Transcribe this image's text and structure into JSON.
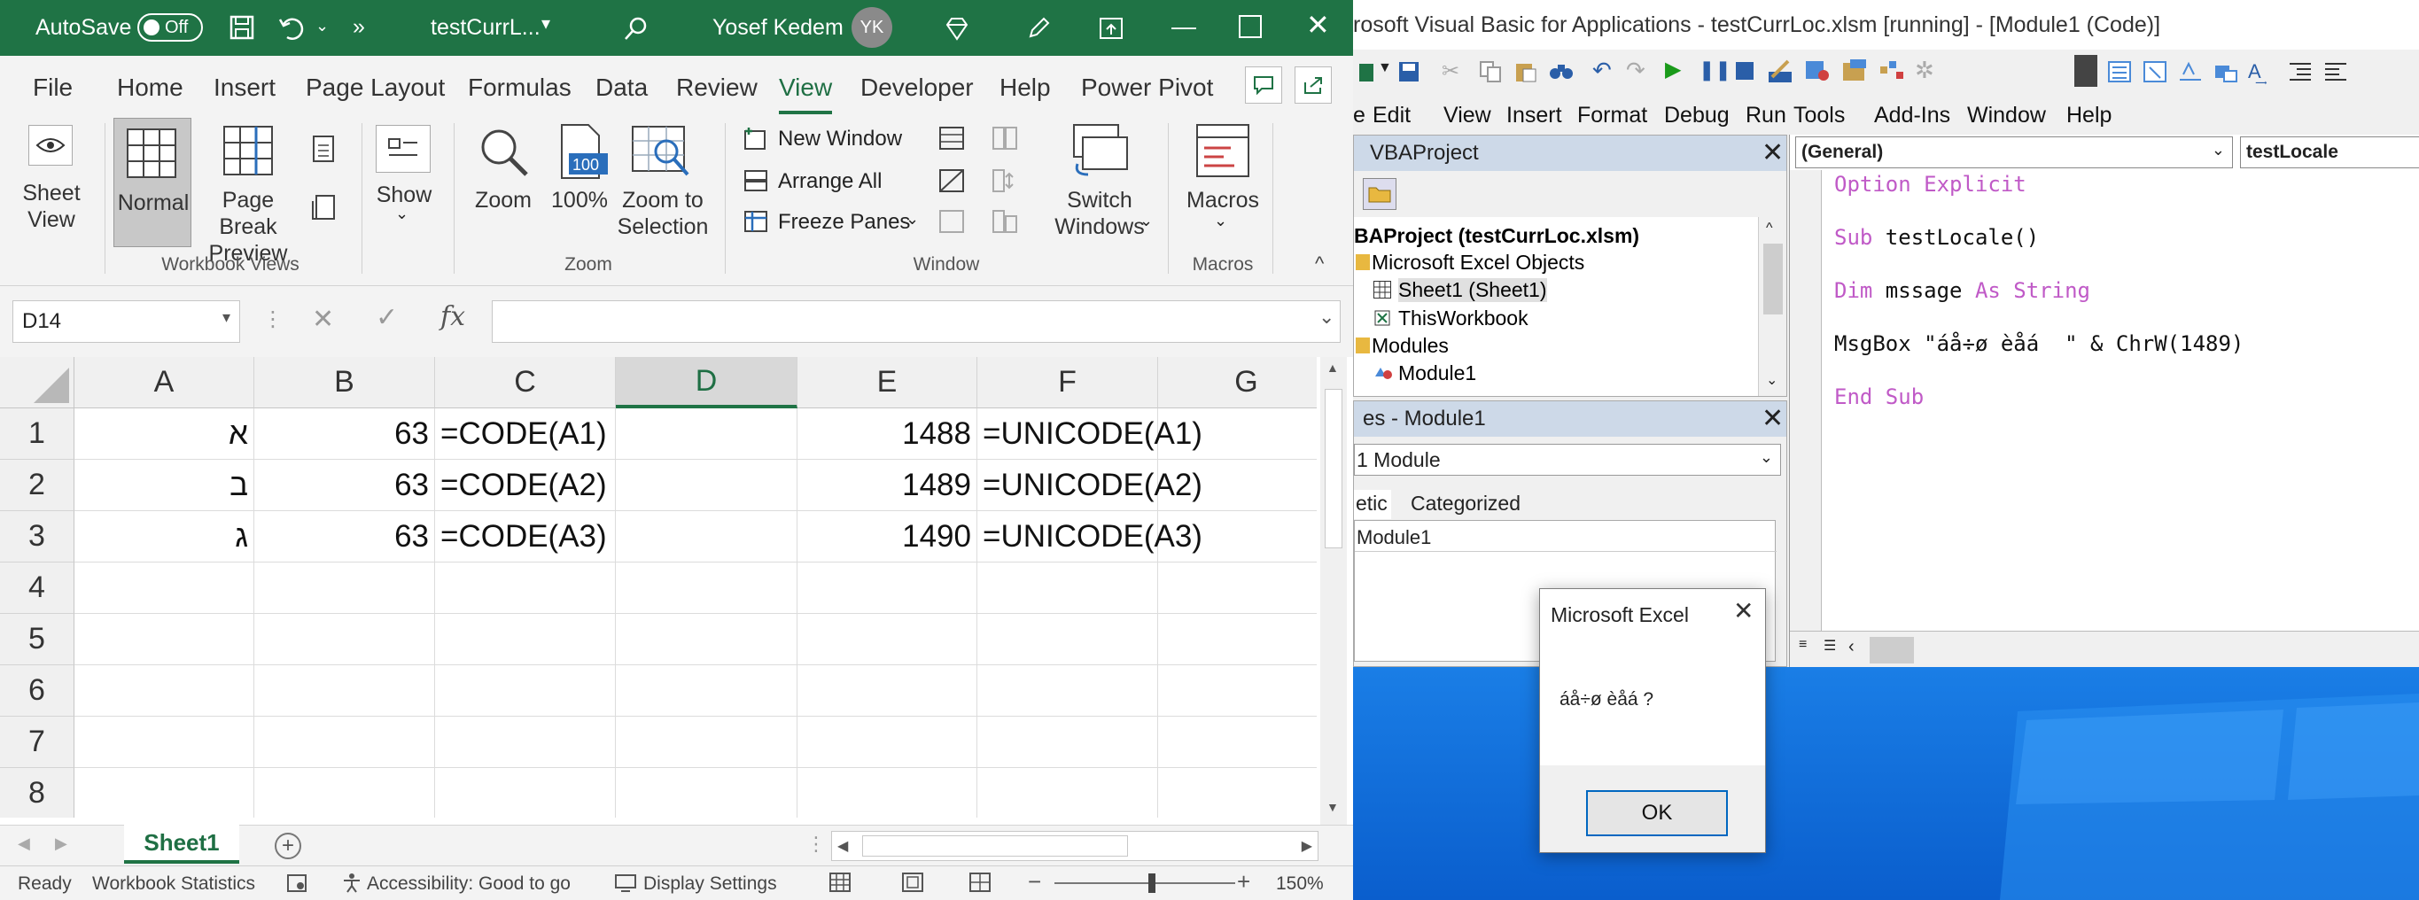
{
  "excel": {
    "title_bar": {
      "autosave_label": "AutoSave",
      "autosave_state": "Off",
      "overflow": "»",
      "filename": "testCurrL...",
      "user_name": "Yosef Kedem",
      "user_initials": "YK"
    },
    "menu": {
      "tabs": [
        "File",
        "Home",
        "Insert",
        "Page Layout",
        "Formulas",
        "Data",
        "Review",
        "View",
        "Developer",
        "Help",
        "Power Pivot"
      ],
      "active_tab": "View"
    },
    "ribbon": {
      "sheet_view": "Sheet View",
      "normal": "Normal",
      "page_break_preview": "Page Break Preview",
      "show": "Show",
      "zoom": "Zoom",
      "zoom_100": "100%",
      "zoom_100_badge": "100",
      "zoom_to_selection": "Zoom to Selection",
      "new_window": "New Window",
      "arrange_all": "Arrange All",
      "freeze_panes": "Freeze Panes",
      "switch_windows": "Switch Windows",
      "macros": "Macros",
      "groups": {
        "workbook_views": "Workbook Views",
        "zoom": "Zoom",
        "window": "Window",
        "macros": "Macros"
      }
    },
    "formula_bar": {
      "name_box": "D14",
      "fx": "fx",
      "value": ""
    },
    "grid": {
      "columns": [
        "A",
        "B",
        "C",
        "D",
        "E",
        "F",
        "G"
      ],
      "selected_column": "D",
      "rows": [
        {
          "num": "1",
          "A": "א",
          "B": "63",
          "C": "=CODE(A1)",
          "D": "",
          "E": "1488",
          "F": "=UNICODE(A1)",
          "G": ""
        },
        {
          "num": "2",
          "A": "ב",
          "B": "63",
          "C": "=CODE(A2)",
          "D": "",
          "E": "1489",
          "F": "=UNICODE(A2)",
          "G": ""
        },
        {
          "num": "3",
          "A": "ג",
          "B": "63",
          "C": "=CODE(A3)",
          "D": "",
          "E": "1490",
          "F": "=UNICODE(A3)",
          "G": ""
        },
        {
          "num": "4"
        },
        {
          "num": "5"
        },
        {
          "num": "6"
        },
        {
          "num": "7"
        },
        {
          "num": "8"
        }
      ]
    },
    "sheet_tab": "Sheet1",
    "status_bar": {
      "ready": "Ready",
      "workbook_statistics": "Workbook Statistics",
      "accessibility": "Accessibility: Good to go",
      "display_settings": "Display Settings",
      "zoom_level": "150%"
    }
  },
  "vba": {
    "title": "rosoft Visual Basic for Applications - testCurrLoc.xlsm [running] - [Module1 (Code)]",
    "menu": [
      "e",
      "Edit",
      "View",
      "Insert",
      "Format",
      "Debug",
      "Run",
      "Tools",
      "Add-Ins",
      "Window",
      "Help"
    ],
    "project_pane": {
      "title": "VBAProject",
      "nodes": [
        "BAProject (testCurrLoc.xlsm)",
        "Microsoft Excel Objects",
        "Sheet1 (Sheet1)",
        "ThisWorkbook",
        "Modules",
        "Module1"
      ]
    },
    "properties_pane": {
      "title": "es - Module1",
      "object": "1 Module",
      "tab_alphabetic": "etic",
      "tab_categorized": "Categorized",
      "name_value": "Module1"
    },
    "code_pane": {
      "object_combo": "(General)",
      "procedure_combo": "testLocale",
      "lines": {
        "l1_kw": "Option Explicit",
        "l2_kw": "Sub",
        "l2_rest": " testLocale()",
        "l3_kw1": "Dim",
        "l3_mid": " mssage ",
        "l3_kw2": "As String",
        "l4": "MsgBox \"áå÷ø èåá  \" & ChrW(1489)",
        "l5_kw": "End Sub"
      }
    }
  },
  "dialog": {
    "title": "Microsoft Excel",
    "message": "áå÷ø èåá  ?",
    "ok_label": "OK"
  },
  "colors": {
    "excel_green": "#1f7345",
    "ribbon_bg": "#f3f3f3",
    "vba_keyword": "#c05ac7",
    "desktop_blue": "#0a5ecd",
    "dialog_button_border": "#0067c0"
  }
}
